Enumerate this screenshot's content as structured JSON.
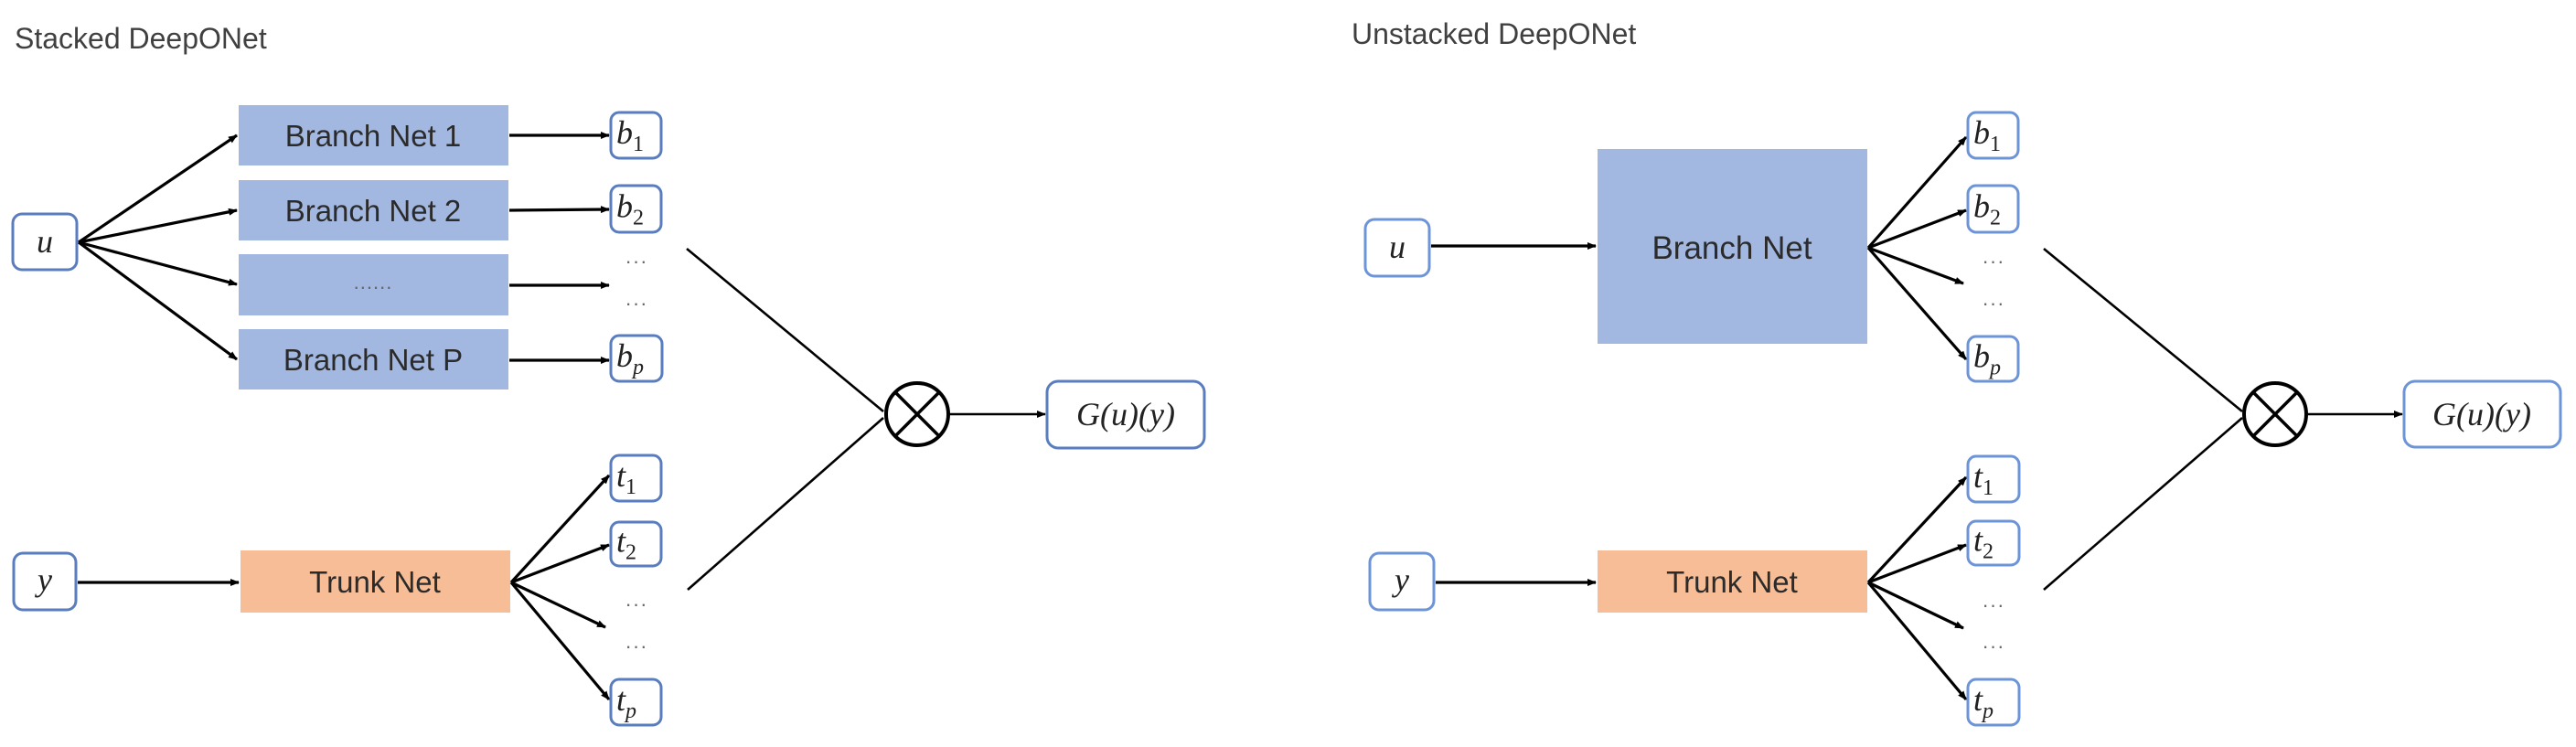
{
  "diagrams": [
    {
      "id": "stacked",
      "title": "Stacked DeepONet",
      "input_u": "u",
      "input_y": "y",
      "branch_nets": [
        "Branch Net 1",
        "Branch Net 2",
        "......",
        "Branch Net P"
      ],
      "branch_outputs": [
        {
          "base": "b",
          "sub": "1",
          "sub_italic": false
        },
        {
          "base": "b",
          "sub": "2",
          "sub_italic": false
        },
        {
          "base": "b",
          "sub": "p",
          "sub_italic": true
        }
      ],
      "trunk_net": "Trunk Net",
      "trunk_outputs": [
        {
          "base": "t",
          "sub": "1",
          "sub_italic": false
        },
        {
          "base": "t",
          "sub": "2",
          "sub_italic": false
        },
        {
          "base": "t",
          "sub": "p",
          "sub_italic": true
        }
      ],
      "ellipsis": "···",
      "operator": "circled-times",
      "output": "G(u)(y)"
    },
    {
      "id": "unstacked",
      "title": "Unstacked DeepONet",
      "input_u": "u",
      "input_y": "y",
      "branch_net": "Branch Net",
      "branch_outputs": [
        {
          "base": "b",
          "sub": "1",
          "sub_italic": false
        },
        {
          "base": "b",
          "sub": "2",
          "sub_italic": false
        },
        {
          "base": "b",
          "sub": "p",
          "sub_italic": true
        }
      ],
      "trunk_net": "Trunk Net",
      "trunk_outputs": [
        {
          "base": "t",
          "sub": "1",
          "sub_italic": false
        },
        {
          "base": "t",
          "sub": "2",
          "sub_italic": false
        },
        {
          "base": "t",
          "sub": "p",
          "sub_italic": true
        }
      ],
      "ellipsis": "···",
      "operator": "circled-times",
      "output": "G(u)(y)"
    }
  ],
  "colors": {
    "branch_fill": "#a3b8e1",
    "trunk_fill": "#f6bd97",
    "variable_border": "#5a7dbf"
  }
}
